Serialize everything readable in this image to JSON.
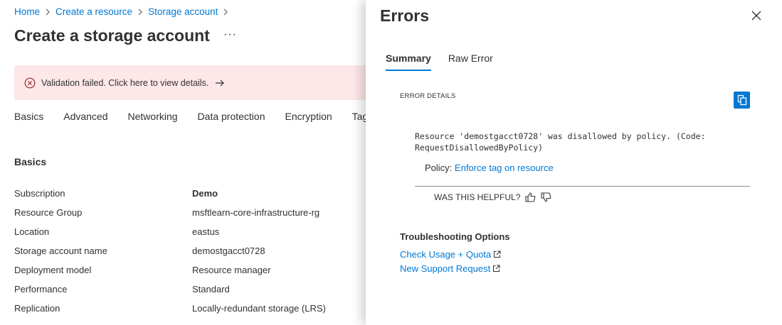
{
  "breadcrumb": {
    "items": [
      "Home",
      "Create a resource",
      "Storage account"
    ]
  },
  "page": {
    "title": "Create a storage account",
    "more_label": "···"
  },
  "banner": {
    "message": "Validation failed. Click here to view details."
  },
  "tabs": [
    "Basics",
    "Advanced",
    "Networking",
    "Data protection",
    "Encryption",
    "Tag"
  ],
  "section": {
    "title": "Basics",
    "rows": [
      {
        "label": "Subscription",
        "value": "Demo"
      },
      {
        "label": "Resource Group",
        "value": "msftlearn-core-infrastructure-rg"
      },
      {
        "label": "Location",
        "value": "eastus"
      },
      {
        "label": "Storage account name",
        "value": "demostgacct0728"
      },
      {
        "label": "Deployment model",
        "value": "Resource manager"
      },
      {
        "label": "Performance",
        "value": "Standard"
      },
      {
        "label": "Replication",
        "value": "Locally-redundant storage (LRS)"
      }
    ]
  },
  "errors_panel": {
    "title": "Errors",
    "tabs": [
      "Summary",
      "Raw Error"
    ],
    "error_details_label": "ERROR DETAILS",
    "error_message": "Resource 'demostgacct0728' was disallowed by policy. (Code: RequestDisallowedByPolicy)",
    "policy_label": "Policy:",
    "policy_link": "Enforce tag on resource",
    "helpful_label": "WAS THIS HELPFUL?",
    "troubleshooting_title": "Troubleshooting Options",
    "links": [
      "Check Usage + Quota",
      "New Support Request"
    ]
  },
  "colors": {
    "accent": "#0078d4",
    "error": "#a4262c",
    "banner_bg": "#fde7e9"
  },
  "icons": [
    "chevron-right-icon",
    "error-circle-icon",
    "arrow-right-icon",
    "close-icon",
    "copy-icon",
    "thumbs-up-icon",
    "thumbs-down-icon",
    "external-link-icon"
  ]
}
